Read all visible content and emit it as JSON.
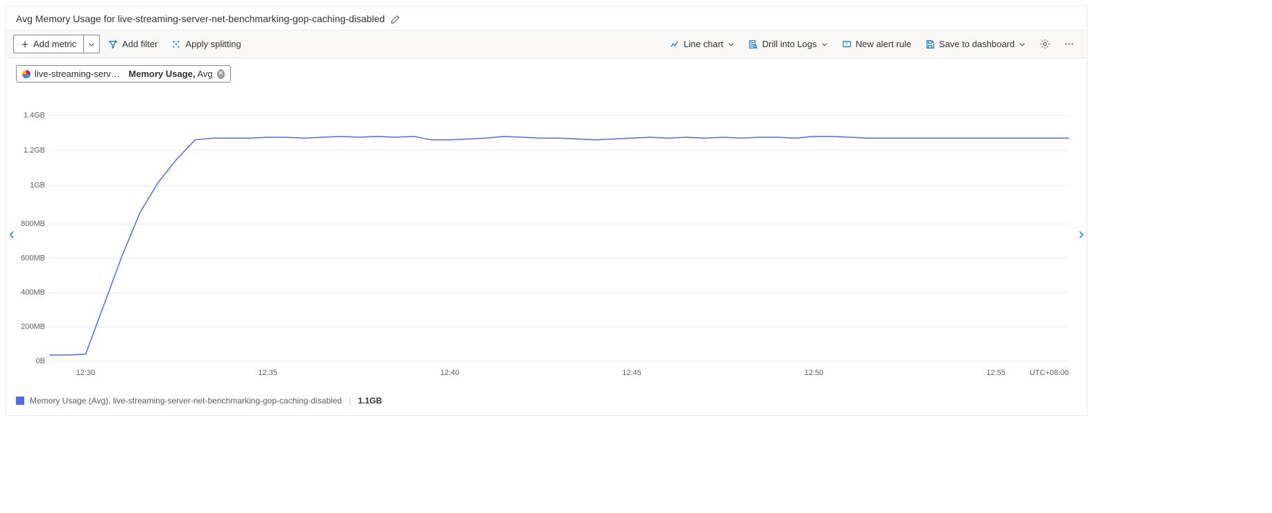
{
  "title": "Avg Memory Usage for live-streaming-server-net-benchmarking-gop-caching-disabled",
  "toolbar": {
    "add_metric": "Add metric",
    "add_filter": "Add filter",
    "apply_splitting": "Apply splitting",
    "chart_type": "Line chart",
    "drill_logs": "Drill into Logs",
    "new_alert": "New alert rule",
    "save_dashboard": "Save to dashboard"
  },
  "chip": {
    "resource": "live-streaming-server-net-...",
    "metric": "Memory Usage,",
    "agg": "Avg"
  },
  "legend": {
    "label": "Memory Usage (Avg), live-streaming-server-net-benchmarking-gop-caching-disabled",
    "value": "1.1GB"
  },
  "chart_data": {
    "type": "line",
    "title": "Avg Memory Usage for live-streaming-server-net-benchmarking-gop-caching-disabled",
    "xlabel": "",
    "ylabel": "",
    "y_unit": "bytes",
    "y_ticks": [
      0,
      209715200,
      419430400,
      629145600,
      838860800,
      1073741824,
      1288490189,
      1503238554
    ],
    "y_tick_labels": [
      "0B",
      "200MB",
      "400MB",
      "600MB",
      "800MB",
      "1GB",
      "1.2GB",
      "1.4GB"
    ],
    "x_tick_labels": [
      "12:30",
      "12:35",
      "12:40",
      "12:45",
      "12:50",
      "12:55"
    ],
    "timezone": "UTC+08:00",
    "x": [
      "12:29:00",
      "12:29:30",
      "12:30:00",
      "12:30:30",
      "12:31:00",
      "12:31:30",
      "12:32:00",
      "12:32:30",
      "12:33:00",
      "12:33:30",
      "12:34:00",
      "12:34:30",
      "12:35:00",
      "12:35:30",
      "12:36:00",
      "12:36:30",
      "12:37:00",
      "12:37:30",
      "12:38:00",
      "12:38:30",
      "12:39:00",
      "12:39:30",
      "12:40:00",
      "12:40:30",
      "12:41:00",
      "12:41:30",
      "12:42:00",
      "12:42:30",
      "12:43:00",
      "12:43:30",
      "12:44:00",
      "12:44:30",
      "12:45:00",
      "12:45:30",
      "12:46:00",
      "12:46:30",
      "12:47:00",
      "12:47:30",
      "12:48:00",
      "12:48:30",
      "12:49:00",
      "12:49:30",
      "12:50:00",
      "12:50:30",
      "12:51:00",
      "12:51:30",
      "12:52:00",
      "12:52:30",
      "12:53:00",
      "12:53:30",
      "12:54:00",
      "12:54:30",
      "12:55:00",
      "12:55:30",
      "12:56:00",
      "12:56:30",
      "12:57:00"
    ],
    "series": [
      {
        "name": "Memory Usage (Avg)",
        "color": "#4f6bed",
        "values_gb": [
          0.035,
          0.035,
          0.04,
          0.32,
          0.6,
          0.85,
          1.02,
          1.15,
          1.26,
          1.27,
          1.27,
          1.27,
          1.275,
          1.275,
          1.27,
          1.275,
          1.28,
          1.275,
          1.28,
          1.275,
          1.28,
          1.26,
          1.26,
          1.265,
          1.27,
          1.28,
          1.275,
          1.27,
          1.27,
          1.265,
          1.26,
          1.265,
          1.27,
          1.275,
          1.27,
          1.275,
          1.27,
          1.275,
          1.27,
          1.275,
          1.275,
          1.27,
          1.28,
          1.28,
          1.275,
          1.27,
          1.27,
          1.27,
          1.27,
          1.27,
          1.27,
          1.27,
          1.27,
          1.27,
          1.27,
          1.27,
          1.27
        ]
      }
    ],
    "ylim_gb": [
      0,
      1.5
    ]
  },
  "colors": {
    "line": "#4f6bed",
    "grid": "#edebe9",
    "axis_text": "#605e5c",
    "accent": "#0078d4"
  }
}
